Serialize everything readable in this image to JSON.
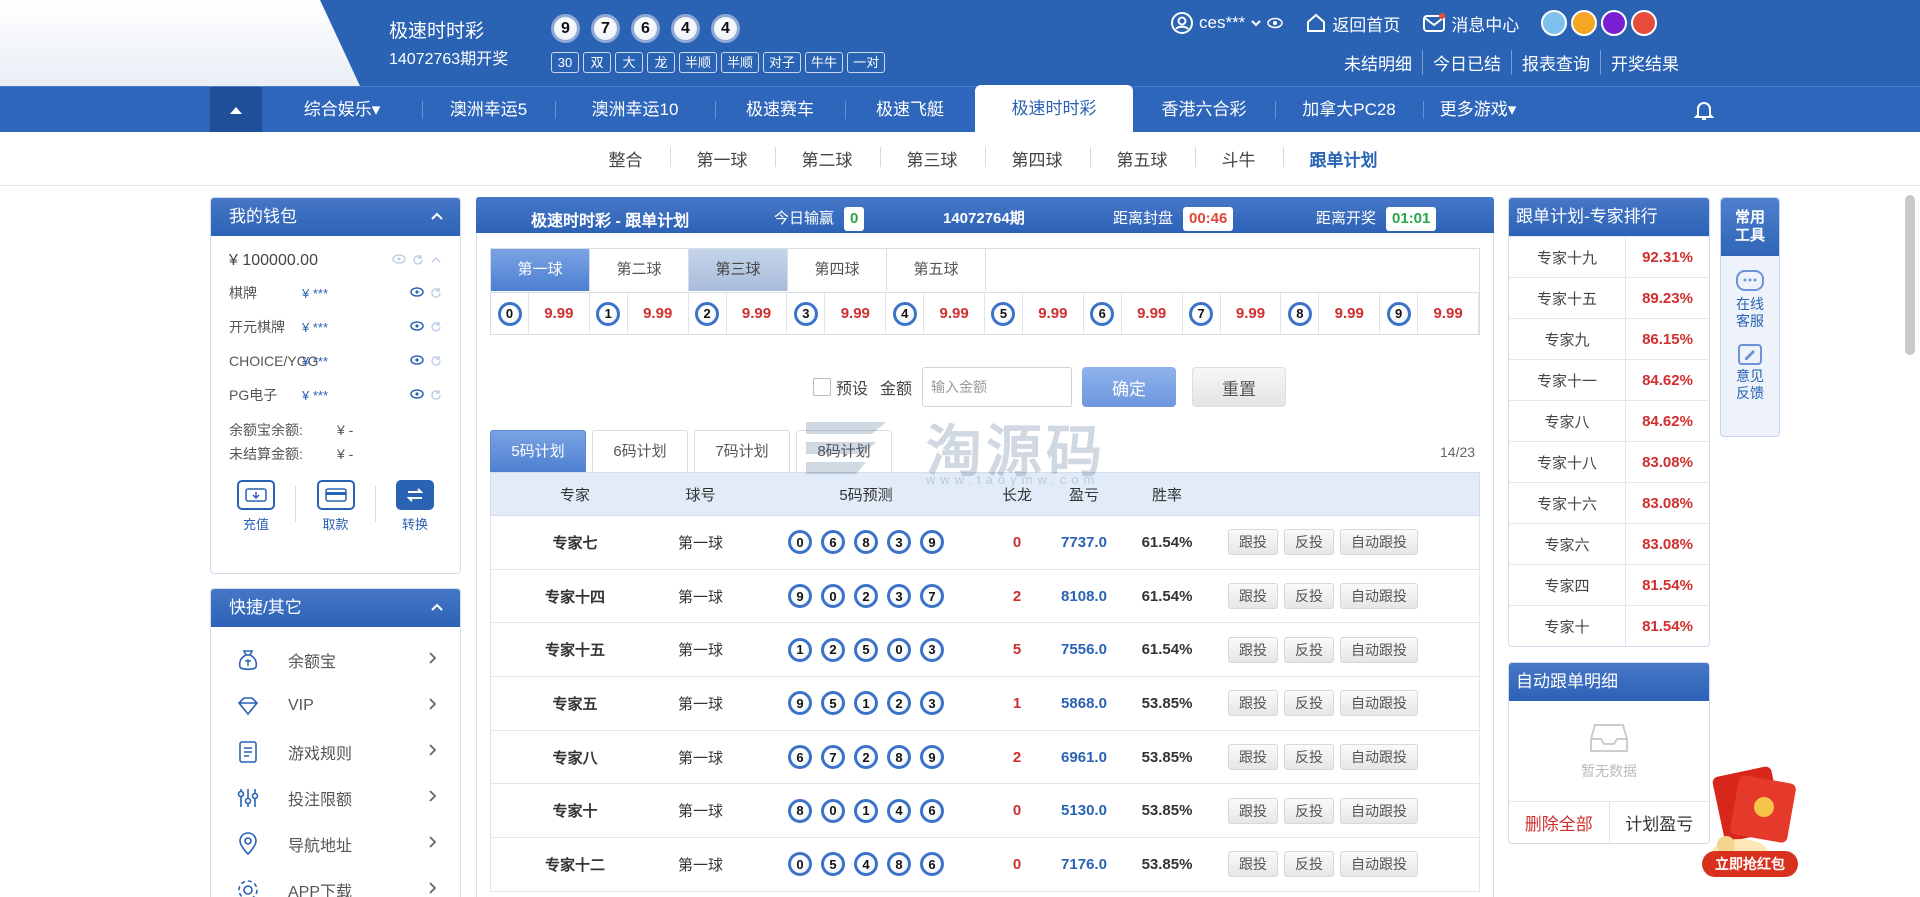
{
  "header": {
    "lottery_name": "极速时时彩",
    "issue_text": "14072763期开奖",
    "balls": [
      "9",
      "7",
      "6",
      "4",
      "4"
    ],
    "tags": [
      "30",
      "双",
      "大",
      "龙",
      "半顺",
      "半顺",
      "对子",
      "牛牛",
      "一对"
    ],
    "user": "ces***",
    "home_label": "返回首页",
    "message_label": "消息中心",
    "theme_colors": [
      "#7ec0ee",
      "#f5a623",
      "#7a1fd1",
      "#e74c3c"
    ],
    "links": [
      "未结明细",
      "今日已结",
      "报表查询",
      "开奖结果"
    ]
  },
  "nav": {
    "items": [
      "综合娱乐▾",
      "澳洲幸运5",
      "澳洲幸运10",
      "极速赛车",
      "极速飞艇",
      "极速时时彩",
      "香港六合彩",
      "加拿大PC28",
      "更多游戏▾"
    ],
    "active_index": 5
  },
  "subnav": {
    "items": [
      "整合",
      "第一球",
      "第二球",
      "第三球",
      "第四球",
      "第五球",
      "斗牛",
      "跟单计划"
    ],
    "active_index": 7
  },
  "wallet": {
    "title": "我的钱包",
    "balance": "¥ 100000.00",
    "rows": [
      {
        "label": "棋牌",
        "value": "¥ ***"
      },
      {
        "label": "开元棋牌",
        "value": "¥ ***"
      },
      {
        "label": "CHOICE/YGG",
        "value": "¥ ***"
      },
      {
        "label": "PG电子",
        "value": "¥ ***"
      }
    ],
    "yuebao_label": "余额宝余额:",
    "yuebao_value": "¥ -",
    "unsettled_label": "未结算金额:",
    "unsettled_value": "¥ -",
    "actions": [
      "充值",
      "取款",
      "转换"
    ]
  },
  "quick": {
    "title": "快捷/其它",
    "items": [
      {
        "label": "余额宝",
        "icon": "money-bag-icon"
      },
      {
        "label": "VIP",
        "icon": "diamond-icon"
      },
      {
        "label": "游戏规则",
        "icon": "rules-icon"
      },
      {
        "label": "投注限额",
        "icon": "sliders-icon"
      },
      {
        "label": "导航地址",
        "icon": "location-icon"
      },
      {
        "label": "APP下载",
        "icon": "gear-icon"
      }
    ]
  },
  "center": {
    "title": "极速时时彩 - 跟单计划",
    "today_label": "今日输赢",
    "today_value": "0",
    "issue": "14072764期",
    "close_label": "距离封盘",
    "close_time": "00:46",
    "draw_label": "距离开奖",
    "draw_time": "01:01",
    "ball_tabs": [
      "第一球",
      "第二球",
      "第三球",
      "第四球",
      "第五球"
    ],
    "odds": [
      {
        "ball": "0",
        "odd": "9.99"
      },
      {
        "ball": "1",
        "odd": "9.99"
      },
      {
        "ball": "2",
        "odd": "9.99"
      },
      {
        "ball": "3",
        "odd": "9.99"
      },
      {
        "ball": "4",
        "odd": "9.99"
      },
      {
        "ball": "5",
        "odd": "9.99"
      },
      {
        "ball": "6",
        "odd": "9.99"
      },
      {
        "ball": "7",
        "odd": "9.99"
      },
      {
        "ball": "8",
        "odd": "9.99"
      },
      {
        "ball": "9",
        "odd": "9.99"
      }
    ],
    "preset_label": "预设",
    "amount_label": "金额",
    "amount_placeholder": "输入金额",
    "confirm_label": "确定",
    "reset_label": "重置",
    "plan_tabs": [
      "5码计划",
      "6码计划",
      "7码计划",
      "8码计划"
    ],
    "pager": "14/23",
    "table_headers": [
      "专家",
      "球号",
      "5码预测",
      "长龙",
      "盈亏",
      "胜率"
    ],
    "action_labels": [
      "跟投",
      "反投",
      "自动跟投"
    ],
    "rows": [
      {
        "expert": "专家七",
        "ball": "第一球",
        "pred": [
          "0",
          "6",
          "8",
          "3",
          "9"
        ],
        "streak": "0",
        "profit": "7737.0",
        "rate": "61.54%"
      },
      {
        "expert": "专家十四",
        "ball": "第一球",
        "pred": [
          "9",
          "0",
          "2",
          "3",
          "7"
        ],
        "streak": "2",
        "profit": "8108.0",
        "rate": "61.54%"
      },
      {
        "expert": "专家十五",
        "ball": "第一球",
        "pred": [
          "1",
          "2",
          "5",
          "0",
          "3"
        ],
        "streak": "5",
        "profit": "7556.0",
        "rate": "61.54%"
      },
      {
        "expert": "专家五",
        "ball": "第一球",
        "pred": [
          "9",
          "5",
          "1",
          "2",
          "3"
        ],
        "streak": "1",
        "profit": "5868.0",
        "rate": "53.85%"
      },
      {
        "expert": "专家八",
        "ball": "第一球",
        "pred": [
          "6",
          "7",
          "2",
          "8",
          "9"
        ],
        "streak": "2",
        "profit": "6961.0",
        "rate": "53.85%"
      },
      {
        "expert": "专家十",
        "ball": "第一球",
        "pred": [
          "8",
          "0",
          "1",
          "4",
          "6"
        ],
        "streak": "0",
        "profit": "5130.0",
        "rate": "53.85%"
      },
      {
        "expert": "专家十二",
        "ball": "第一球",
        "pred": [
          "0",
          "5",
          "4",
          "8",
          "6"
        ],
        "streak": "0",
        "profit": "7176.0",
        "rate": "53.85%"
      }
    ]
  },
  "watermark": {
    "main": "淘源码",
    "sub": "www.taoymw.com"
  },
  "ranking": {
    "title": "跟单计划-专家排行",
    "items": [
      {
        "name": "专家十九",
        "rate": "92.31%"
      },
      {
        "name": "专家十五",
        "rate": "89.23%"
      },
      {
        "name": "专家九",
        "rate": "86.15%"
      },
      {
        "name": "专家十一",
        "rate": "84.62%"
      },
      {
        "name": "专家八",
        "rate": "84.62%"
      },
      {
        "name": "专家十八",
        "rate": "83.08%"
      },
      {
        "name": "专家十六",
        "rate": "83.08%"
      },
      {
        "name": "专家六",
        "rate": "83.08%"
      },
      {
        "name": "专家四",
        "rate": "81.54%"
      },
      {
        "name": "专家十",
        "rate": "81.54%"
      }
    ]
  },
  "auto": {
    "title": "自动跟单明细",
    "empty": "暂无数据",
    "delete_all": "删除全部",
    "plan_profit": "计划盈亏"
  },
  "tools": {
    "title": "常用工具",
    "service": "在线客服",
    "feedback": "意见反馈"
  },
  "redpack": {
    "button": "立即抢红包"
  }
}
